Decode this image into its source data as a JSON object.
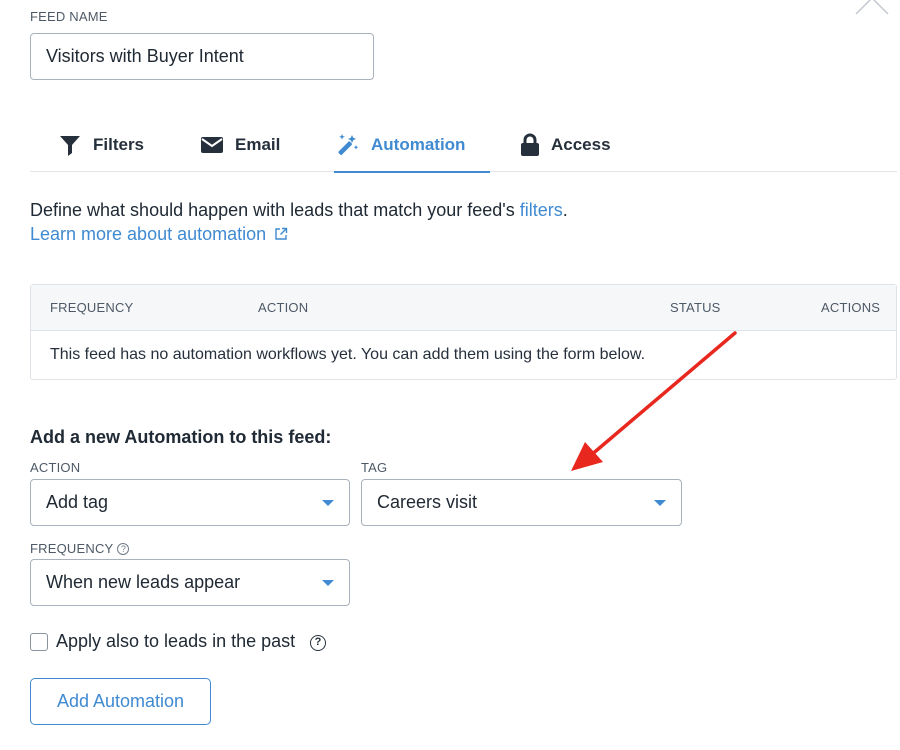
{
  "feed": {
    "label": "FEED NAME",
    "value": "Visitors  with Buyer Intent"
  },
  "tabs": [
    {
      "label": "Filters",
      "icon": "filter-icon"
    },
    {
      "label": "Email",
      "icon": "envelope-icon"
    },
    {
      "label": "Automation",
      "icon": "magic-wand-icon",
      "active": true
    },
    {
      "label": "Access",
      "icon": "lock-icon"
    }
  ],
  "description": {
    "text": "Define what should happen with leads that match your feed's ",
    "link": "filters",
    "end": ".",
    "learn_more": "Learn more about automation"
  },
  "table": {
    "headers": [
      "FREQUENCY",
      "ACTION",
      "STATUS",
      "ACTIONS"
    ],
    "empty_message": "This feed has no automation workflows yet. You can add them using the form below."
  },
  "form": {
    "title": "Add a new Automation to this feed:",
    "action_label": "ACTION",
    "action_value": "Add tag",
    "tag_label": "TAG",
    "tag_value": "Careers visit",
    "frequency_label": "FREQUENCY",
    "frequency_value": "When new leads appear",
    "checkbox_label": "Apply also to leads in the past",
    "checkbox_checked": false,
    "submit_label": "Add Automation"
  },
  "colors": {
    "accent": "#3f8ad1",
    "annotation_arrow": "#e8281f"
  }
}
